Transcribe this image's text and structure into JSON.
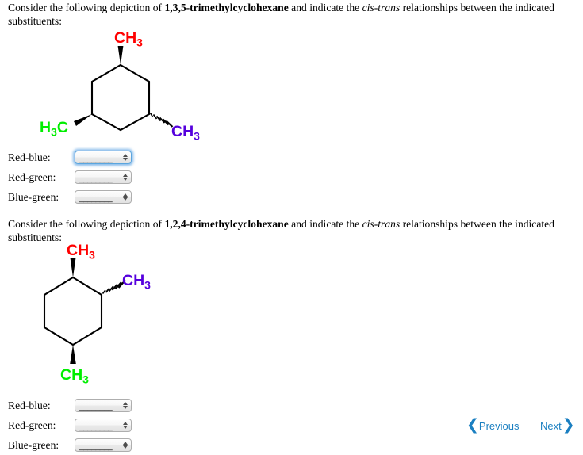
{
  "question_1": {
    "text_before": "Consider the following depiction of ",
    "compound": "1,3,5-trimethylcyclohexane",
    "text_middle": " and indicate the ",
    "italic": "cis-trans",
    "text_after": " relationships between the indicated substituents:",
    "structure": {
      "name": "1,3,5-trimethylcyclohexane",
      "ring": "cyclohexane",
      "substituents": [
        {
          "label": "CH3",
          "color": "#ff0000",
          "color_name": "red",
          "bond": "wedge",
          "position": "top"
        },
        {
          "label": "H3C",
          "color": "#00ee00",
          "color_name": "green",
          "bond": "wedge",
          "position": "bottom-left"
        },
        {
          "label": "CH3",
          "color": "#5500dd",
          "color_name": "blue",
          "bond": "hash",
          "position": "bottom-right"
        }
      ]
    },
    "answers": [
      {
        "label": "Red-blue:",
        "value": "________",
        "focused": true
      },
      {
        "label": "Red-green:",
        "value": "________",
        "focused": false
      },
      {
        "label": "Blue-green:",
        "value": "________",
        "focused": false
      }
    ]
  },
  "question_2": {
    "text_before": "Consider the following depiction of ",
    "compound": "1,2,4-trimethylcyclohexane",
    "text_middle": " and indicate the ",
    "italic": "cis-trans",
    "text_after": " relationships between the indicated substituents:",
    "structure": {
      "name": "1,2,4-trimethylcyclohexane",
      "ring": "cyclohexane",
      "substituents": [
        {
          "label": "CH3",
          "color": "#ff0000",
          "color_name": "red",
          "bond": "wedge",
          "position": "top"
        },
        {
          "label": "CH3",
          "color": "#5500dd",
          "color_name": "blue",
          "bond": "hash",
          "position": "upper-right"
        },
        {
          "label": "CH3",
          "color": "#00ee00",
          "color_name": "green",
          "bond": "wedge",
          "position": "bottom"
        }
      ]
    },
    "answers": [
      {
        "label": "Red-blue:",
        "value": "________",
        "focused": false
      },
      {
        "label": "Red-green:",
        "value": "________",
        "focused": false
      },
      {
        "label": "Blue-green:",
        "value": "________",
        "focused": false
      }
    ]
  },
  "navigation": {
    "previous_label": "Previous",
    "next_label": "Next",
    "previous_chevron": "❮",
    "next_chevron": "❯",
    "link_color": "#1a7fc1"
  }
}
